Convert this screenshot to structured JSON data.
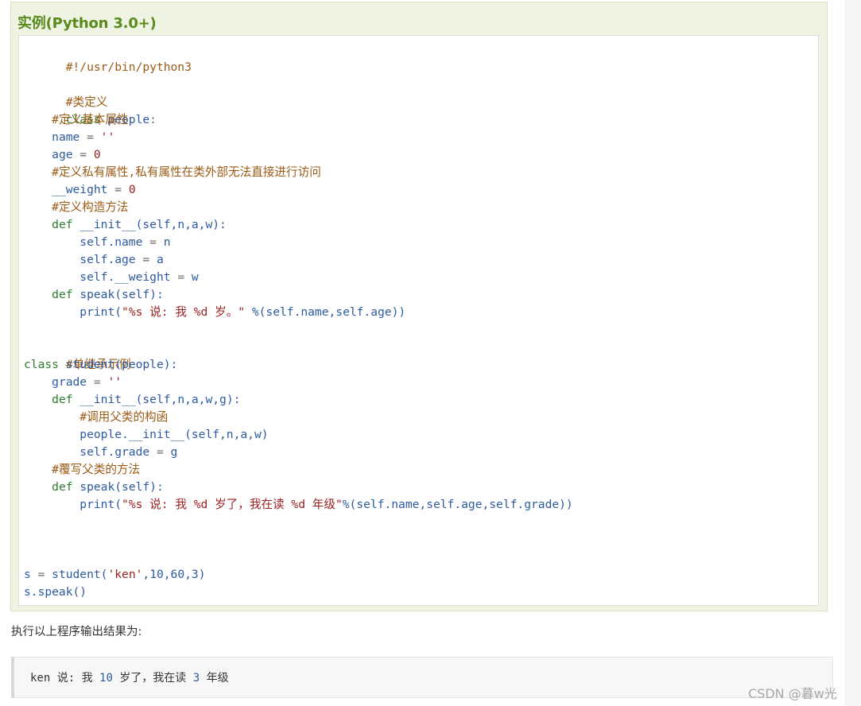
{
  "example": {
    "title": "实例(Python 3.0+)",
    "code": {
      "shebang": "#!/usr/bin/python3",
      "c_class_def": "#类定义",
      "kw_class": "class",
      "people": "people",
      "colon": ":",
      "c_basic_attr": "#定义基本属性",
      "name_var": "name",
      "eq": " = ",
      "empty_str": "''",
      "age_var": "age",
      "zero": "0",
      "c_private_attr": "#定义私有属性,私有属性在类外部无法直接进行访问",
      "weight_var": "__weight",
      "c_ctor": "#定义构造方法",
      "kw_def": "def",
      "init": "__init__",
      "params4": "(self,n,a,w):",
      "self_name": "self.name",
      "n": "n",
      "self_age": "self.age",
      "a": "a",
      "self_weight": "self.__weight",
      "w": "w",
      "speak": "speak",
      "params_self": "(self):",
      "print": "print",
      "str1": "\"%s 说: 我 %d 岁。\"",
      "fmt1": " %(self.name,self.age))",
      "paren_open": "(",
      "c_single": "#单继承示例",
      "student": "student",
      "inherit": "(people):",
      "grade_var": "grade",
      "params5": "(self,n,a,w,g):",
      "c_call_parent": "#调用父类的构函",
      "people_init": "people.__init__",
      "params_call": "(self,n,a,w)",
      "self_grade": "self.grade",
      "g": "g",
      "c_override": "#覆写父类的方法",
      "str2": "\"%s 说: 我 %d 岁了，我在读 %d 年级\"",
      "fmt2": "%(self.name,self.age,self.grade))",
      "s_var": "s",
      "student_call": "student",
      "args_open": "(",
      "ken_str": "'ken'",
      "args_rest": ",10,60,3)",
      "speak_call": "s.speak()"
    }
  },
  "output": {
    "label": "执行以上程序输出结果为:",
    "line_a": "ken 说: 我 ",
    "n10": "10",
    "line_b": " 岁了，我在读 ",
    "n3": "3",
    "line_c": " 年级"
  },
  "watermark": "CSDN @暮w光",
  "colors": {
    "title_green": "#5a8a1e",
    "comment": "#9b5a14",
    "keyword": "#2b7d2b",
    "identifier": "#2d5aa0",
    "string": "#9a1e1e"
  }
}
